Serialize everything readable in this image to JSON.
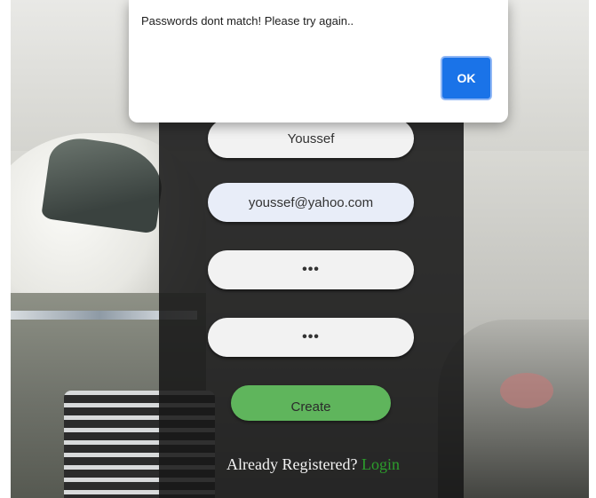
{
  "alert": {
    "message": "Passwords dont match! Please try again..",
    "ok_label": "OK"
  },
  "form": {
    "name_value": "Youssef",
    "email_value": "youssef@yahoo.com",
    "password_mask": "•••",
    "confirm_password_mask": "•••",
    "create_label": "Create",
    "already_registered_text": "Already Registered? ",
    "login_link": "Login"
  },
  "colors": {
    "panel": "#181818",
    "create_button": "#5fb55c",
    "login_link": "#2c9d2c",
    "ok_button": "#1a73e8"
  }
}
